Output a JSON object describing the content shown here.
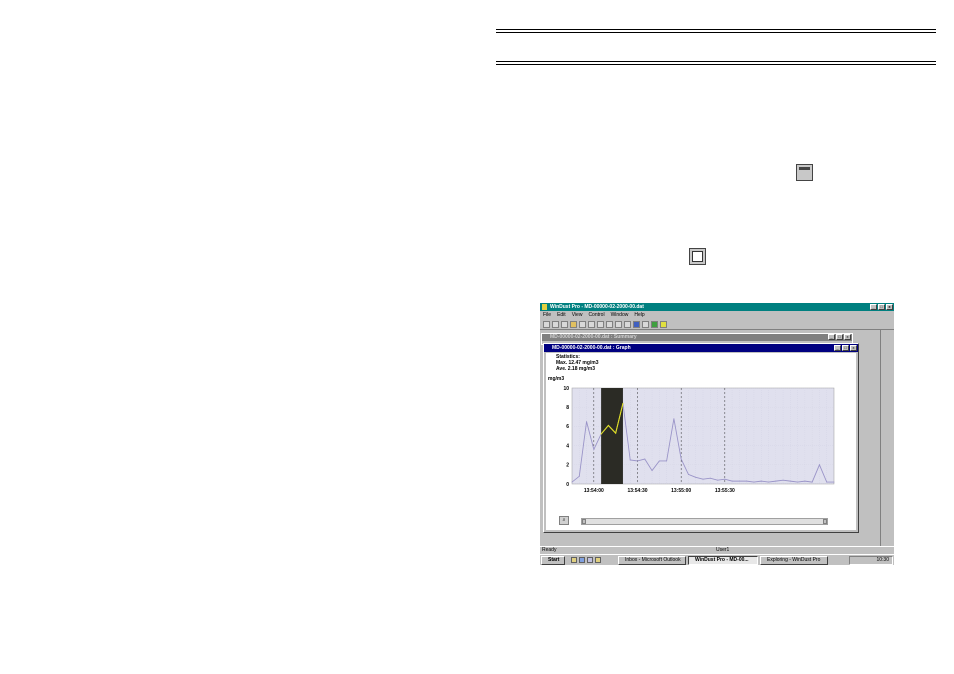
{
  "app": {
    "title": "WinDust Pro - MD-00000-02-2000-00.dat",
    "menu": [
      "File",
      "Edit",
      "View",
      "Control",
      "Window",
      "Help"
    ],
    "summary_window_title": "MD-00000-02-2000-00.dat : Summary",
    "graph_window_title": "MD-00000-02-2000-00.dat : Graph",
    "statistics": {
      "heading": "Statistics:",
      "max": "Max.  12.47 mg/m3",
      "ave": "Ave.  2.18 mg/m3"
    },
    "status": {
      "left": "Ready",
      "user": "User1"
    },
    "taskbar": {
      "start": "Start",
      "items": [
        "Inbox - Microsoft Outlook",
        "WinDust Pro - MD-00...",
        "Exploring - WinDust Pro"
      ],
      "clock": "10:30"
    }
  },
  "colors": {
    "title_active": "#000080",
    "title_inactive": "#808080",
    "app_title": "#008080",
    "plot_background": "#e0e0ee",
    "selection": "#2b2b25",
    "series_line": "#9a94c8",
    "selected_line": "#e0e020"
  },
  "chart_data": {
    "type": "line",
    "ylabel": "mg/m3",
    "ylim": [
      0,
      10
    ],
    "yticks": [
      0,
      2,
      4,
      6,
      8,
      10
    ],
    "xticks": [
      "13:54:00",
      "13:54:30",
      "13:55:00",
      "13:55:30"
    ],
    "x_range_seconds": [
      0,
      36
    ],
    "tick_interval_points": 6,
    "selection_range": [
      4,
      7
    ],
    "series": [
      {
        "values": [
          0.2,
          0.8,
          6.5,
          3.6,
          5.2,
          6.1,
          5.3,
          8.4,
          2.5,
          2.4,
          2.6,
          1.4,
          2.4,
          2.4,
          6.8,
          2.6,
          1.0,
          0.7,
          0.5,
          0.6,
          0.4,
          0.5,
          0.3,
          0.3,
          0.3,
          0.2,
          0.3,
          0.2,
          0.3,
          0.4,
          0.3,
          0.2,
          0.3,
          0.2,
          2.0,
          0.2,
          0.2
        ]
      }
    ]
  }
}
